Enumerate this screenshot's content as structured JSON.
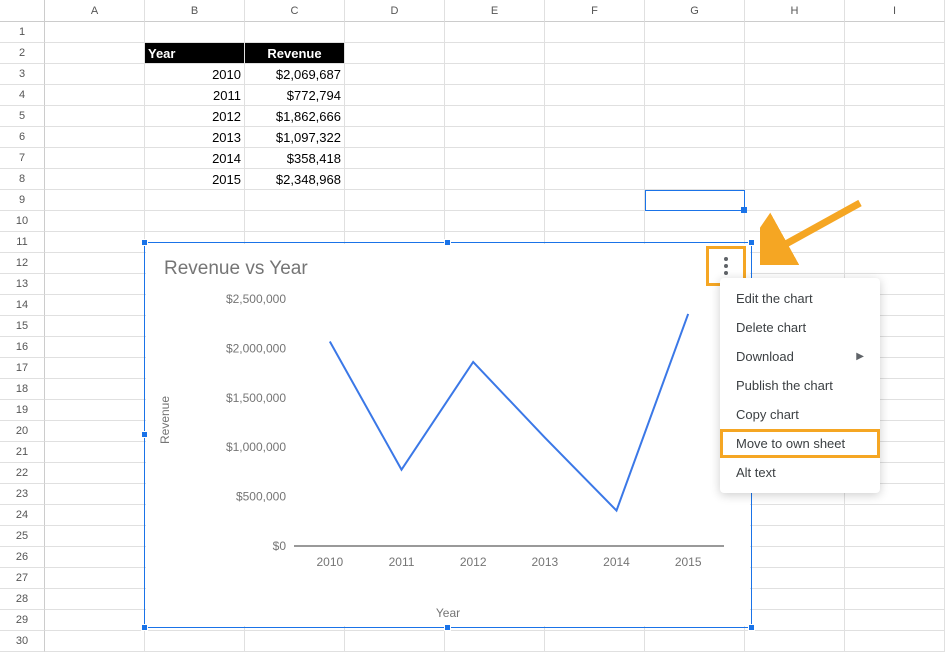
{
  "columns": [
    "A",
    "B",
    "C",
    "D",
    "E",
    "F",
    "G",
    "H",
    "I"
  ],
  "rowCount": 30,
  "table": {
    "headers": {
      "year": "Year",
      "revenue": "Revenue"
    },
    "rows": [
      {
        "year": "2010",
        "revenue": "$2,069,687"
      },
      {
        "year": "2011",
        "revenue": "$772,794"
      },
      {
        "year": "2012",
        "revenue": "$1,862,666"
      },
      {
        "year": "2013",
        "revenue": "$1,097,322"
      },
      {
        "year": "2014",
        "revenue": "$358,418"
      },
      {
        "year": "2015",
        "revenue": "$2,348,968"
      }
    ]
  },
  "selected_cell": "G9",
  "chart": {
    "title": "Revenue vs Year",
    "xlabel": "Year",
    "ylabel": "Revenue"
  },
  "chart_data": {
    "type": "line",
    "categories": [
      "2010",
      "2011",
      "2012",
      "2013",
      "2014",
      "2015"
    ],
    "values": [
      2069687,
      772794,
      1862666,
      1097322,
      358418,
      2348968
    ],
    "title": "Revenue vs Year",
    "xlabel": "Year",
    "ylabel": "Revenue",
    "ylim": [
      0,
      2500000
    ],
    "yticks": [
      0,
      500000,
      1000000,
      1500000,
      2000000,
      2500000
    ],
    "ytick_labels": [
      "$0",
      "$500,000",
      "$1,000,000",
      "$1,500,000",
      "$2,000,000",
      "$2,500,000"
    ]
  },
  "menu": {
    "items": [
      {
        "label": "Edit the chart",
        "key": "edit"
      },
      {
        "label": "Delete chart",
        "key": "delete"
      },
      {
        "label": "Download",
        "key": "download",
        "submenu": true
      },
      {
        "label": "Publish the chart",
        "key": "publish"
      },
      {
        "label": "Copy chart",
        "key": "copy"
      },
      {
        "label": "Move to own sheet",
        "key": "move",
        "highlighted": true
      },
      {
        "label": "Alt text",
        "key": "alt"
      }
    ]
  },
  "colors": {
    "highlight": "#f5a623",
    "selection": "#1a73e8",
    "line": "#3b78e7"
  }
}
